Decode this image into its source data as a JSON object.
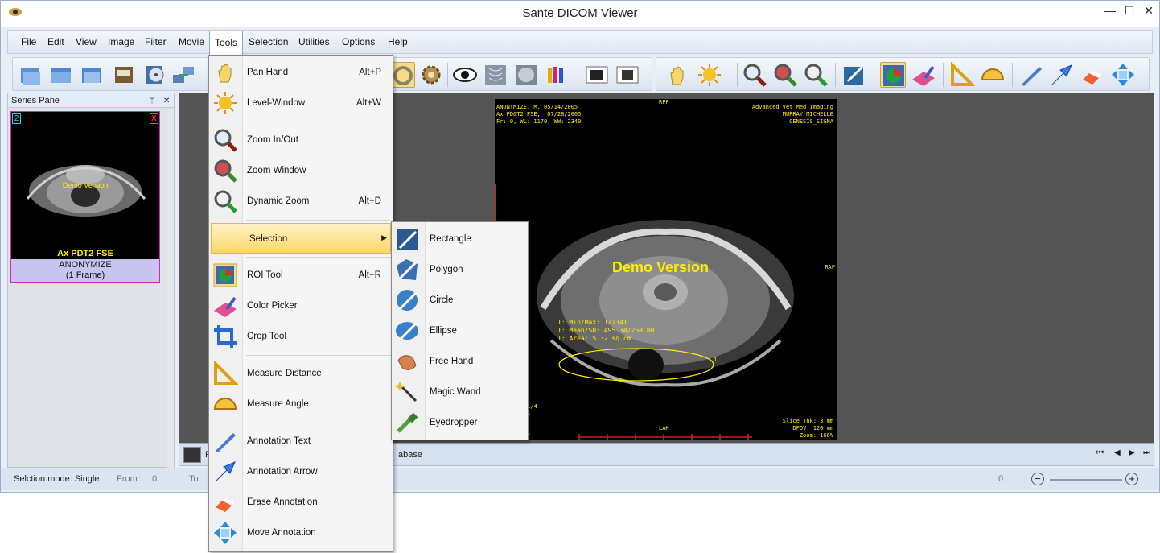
{
  "window": {
    "title": "Sante DICOM Viewer",
    "minimize": "—",
    "maximize": "☐",
    "close": "✕"
  },
  "menubar": [
    "File",
    "Edit",
    "View",
    "Image",
    "Filter",
    "Movie",
    "Tools",
    "Selection",
    "Utilities",
    "Options",
    "Help"
  ],
  "series_pane": {
    "title": "Series Pane",
    "pin": "ᛘ",
    "close": "✕",
    "thumb_index": "2",
    "thumb_close": "X",
    "thumb_watermark": "Demo Version",
    "series_name": "Ax PDT2 FSE",
    "patient": "ANONYMIZE",
    "frames": "(1 Frame)"
  },
  "image_overlay": {
    "top_left": "ANONYMIZE, M, 05/14/2005\nAx PD&T2 FSE,  07/28/2005\nFr: 0, WL: 1170, WW: 2340",
    "top_center": "RPF",
    "top_right": "Advanced Vet Med Imaging\nMURRAY MICHELLE\nGENESIS_SIGNA",
    "right_mid": "RAF",
    "watermark": "Demo Version",
    "roi_stats": "1: Min/Max: 1/1341\n1: Mean/SD: 495.34/250.80\n1: Area: 5.32 sq.cm",
    "roi_label": "1",
    "bottom_center": "LAH",
    "bottom_right": "Slice Thk: 3 mm\nDFOV: 120 mm\nZoom: 166%",
    "bottom_left": "IL/4\nms\ns\nT\n0°"
  },
  "tabbar": {
    "tab_label": "F",
    "database_label": "abase"
  },
  "statusbar": {
    "mode": "Selction mode: Single",
    "from_label": "From:",
    "from_value": "0",
    "to_label": "To:",
    "zoom_value": "0"
  },
  "tools_menu": {
    "items": [
      {
        "label": "Pan Hand",
        "shortcut": "Alt+P"
      },
      {
        "label": "Level-Window",
        "shortcut": "Alt+W"
      },
      {
        "label": "Zoom In/Out",
        "shortcut": ""
      },
      {
        "label": "Zoom Window",
        "shortcut": ""
      },
      {
        "label": "Dynamic Zoom",
        "shortcut": "Alt+D"
      },
      {
        "label": "Selection",
        "shortcut": ""
      },
      {
        "label": "ROI Tool",
        "shortcut": "Alt+R"
      },
      {
        "label": "Color Picker",
        "shortcut": ""
      },
      {
        "label": "Crop Tool",
        "shortcut": ""
      },
      {
        "label": "Measure Distance",
        "shortcut": ""
      },
      {
        "label": "Measure Angle",
        "shortcut": ""
      },
      {
        "label": "Annotation Text",
        "shortcut": ""
      },
      {
        "label": "Annotation Arrow",
        "shortcut": ""
      },
      {
        "label": "Erase Annotation",
        "shortcut": ""
      },
      {
        "label": "Move Annotation",
        "shortcut": ""
      }
    ]
  },
  "selection_submenu": [
    "Rectangle",
    "Polygon",
    "Circle",
    "Ellipse",
    "Free Hand",
    "Magic Wand",
    "Eyedropper"
  ]
}
